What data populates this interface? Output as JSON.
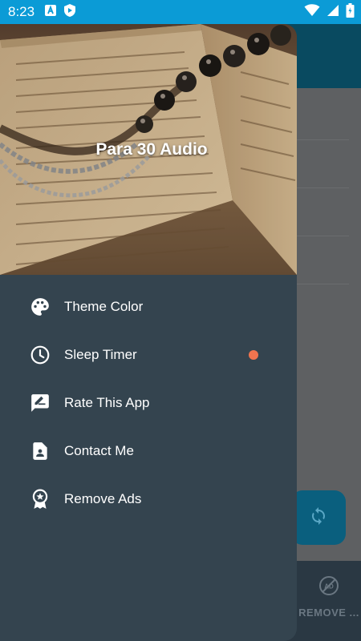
{
  "status_bar": {
    "time": "8:23",
    "left_icons": [
      "a-box-notification-icon",
      "shield-notification-icon"
    ],
    "right_icons": [
      "wifi-icon",
      "signal-icon",
      "battery-icon"
    ]
  },
  "drawer": {
    "title": "Para 30 Audio",
    "menu": [
      {
        "label": "Theme Color",
        "icon": "palette-icon"
      },
      {
        "label": "Sleep Timer",
        "icon": "clock-icon",
        "badge_color": "#f0744f"
      },
      {
        "label": "Rate This App",
        "icon": "rate-review-icon"
      },
      {
        "label": "Contact Me",
        "icon": "contact-card-icon"
      },
      {
        "label": "Remove Ads",
        "icon": "award-badge-icon"
      }
    ]
  },
  "background_app": {
    "bottom_nav_label": "REMOVE ...",
    "bottom_nav_icon": "no-ads-icon",
    "fab_icon": "refresh-icon"
  },
  "colors": {
    "status_bar": "#0b9bd6",
    "drawer_bg": "#34444f",
    "app_bar": "#094a60",
    "accent_dot": "#f0744f"
  }
}
